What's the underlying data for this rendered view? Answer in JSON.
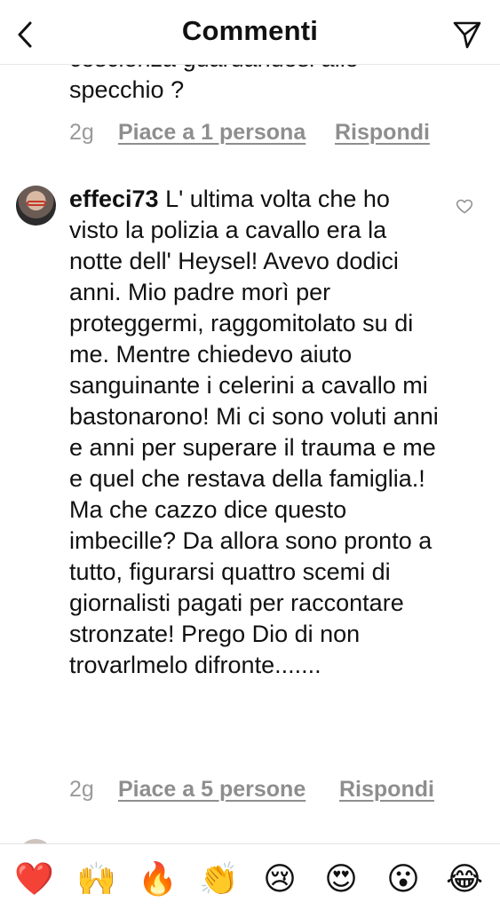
{
  "header": {
    "title": "Commenti",
    "back_icon": "chevron-left-icon",
    "share_icon": "paper-plane-icon"
  },
  "previous_comment": {
    "text_tail": "coscienza guardandosi allo\nspecchio ?",
    "time": "2g",
    "likes": "Piace a 1 persona",
    "reply": "Rispondi"
  },
  "comment": {
    "username": "effeci73",
    "text": "L' ultima volta che ho visto la polizia a cavallo era la notte dell' Heysel! Avevo dodici anni. Mio padre morì per proteggermi, raggomitolato su di me. Mentre chiedevo aiuto sanguinante i celerini a cavallo mi bastonarono! Mi ci sono voluti anni e anni per superare il trauma e me e quel che restava della famiglia.! Ma che cazzo dice questo imbecille? Da allora sono pronto a tutto, figurarsi quattro scemi di giornalisti pagati per raccontare stronzate! Prego Dio di non trovarlmelo difronte.......",
    "time": "2g",
    "likes": "Piace a 5 persone",
    "reply": "Rispondi",
    "like_icon": "heart-outline-icon"
  },
  "emoji_bar": {
    "items": [
      "❤️",
      "🙌",
      "🔥",
      "👏",
      "😢",
      "😍",
      "😮",
      "😂"
    ],
    "names": [
      "red-heart",
      "raising-hands",
      "fire",
      "clapping-hands",
      "crying-face",
      "heart-eyes",
      "open-mouth-face",
      "tears-of-joy"
    ]
  },
  "colors": {
    "text": "#111111",
    "meta": "#8e8e8e",
    "divider": "#e6e6e6"
  }
}
